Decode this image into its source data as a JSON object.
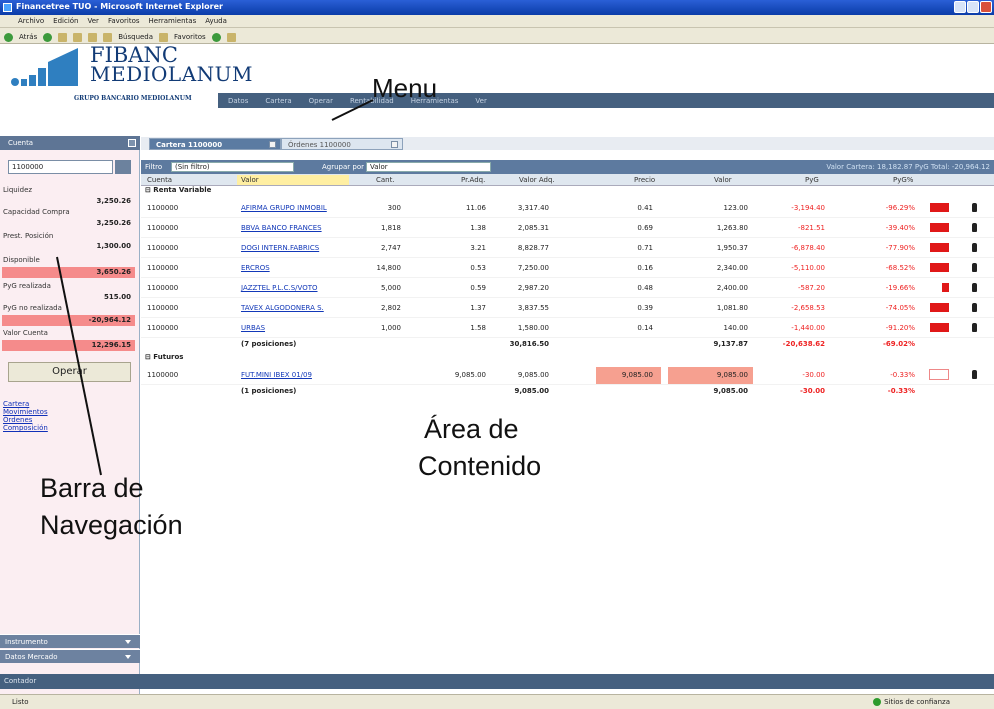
{
  "window": {
    "title": "Financetree TUO - Microsoft Internet Explorer"
  },
  "browser_menu": [
    "Archivo",
    "Edición",
    "Ver",
    "Favoritos",
    "Herramientas",
    "Ayuda"
  ],
  "browser_toolbar": {
    "back": "Atrás",
    "search": "Búsqueda",
    "favorites": "Favoritos"
  },
  "brand": {
    "line1": "FIBANC",
    "line2": "MEDIOLANUM",
    "tagline": "GRUPO BANCARIO MEDIOLANUM"
  },
  "app_menu": [
    "Datos",
    "Cartera",
    "Operar",
    "Rentabilidad",
    "Herramientas",
    "Ver"
  ],
  "overlays": {
    "menu": "Menu",
    "content_l1": "Área de",
    "content_l2": "Contenido",
    "nav_l1": "Barra de",
    "nav_l2": "Navegación"
  },
  "sidebar": {
    "header": "Cuenta",
    "account": "1100000",
    "items": [
      {
        "label": "Liquidez",
        "value": "3,250.26"
      },
      {
        "label": "Capacidad Compra",
        "value": "3,250.26"
      },
      {
        "label": "Prest. Posición",
        "value": "1,300.00"
      },
      {
        "label": "Disponible",
        "value": "3,650.26"
      },
      {
        "label": "PyG realizada",
        "value": "515.00"
      },
      {
        "label": "PyG no realizada",
        "value": "-20,964.12"
      },
      {
        "label": "Valor Cuenta",
        "value": "12,296.15"
      }
    ],
    "operar": "Operar",
    "links": [
      "Cartera",
      "Movimientos",
      "Órdenes",
      "Composición"
    ],
    "bottom": [
      "Instrumento",
      "Datos Mercado",
      "Contador"
    ]
  },
  "content": {
    "tabs": [
      "Cartera 1100000",
      "Órdenes 1100000"
    ],
    "filter": {
      "label": "Filtro",
      "value": "(Sin filtro)",
      "group_label": "Agrupar por",
      "group_value": "Valor"
    },
    "summary": "Valor Cartera: 18,182.87  PyG Total: -20,964.12",
    "columns": [
      "Cuenta",
      "Valor",
      "Cant.",
      "Pr.Adq.",
      "Valor Adq.",
      "Precio",
      "Valor",
      "PyG",
      "PyG%"
    ],
    "groups": [
      {
        "name": "Renta Variable",
        "rows": [
          {
            "account": "1100000",
            "valor": "AFIRMA GRUPO INMOBIL",
            "cant": "300",
            "pradq": "11.06",
            "valoradq": "3,317.40",
            "precio": "0.41",
            "valorcur": "123.00",
            "pyg": "-3,194.40",
            "pygpct": "-96.29%",
            "bar": 0.96
          },
          {
            "account": "1100000",
            "valor": "BBVA BANCO FRANCES",
            "cant": "1,818",
            "pradq": "1.38",
            "valoradq": "2,085.31",
            "precio": "0.69",
            "valorcur": "1,263.80",
            "pyg": "-821.51",
            "pygpct": "-39.40%",
            "bar": 0.96
          },
          {
            "account": "1100000",
            "valor": "DOGI INTERN.FABRICS",
            "cant": "2,747",
            "pradq": "3.21",
            "valoradq": "8,828.77",
            "precio": "0.71",
            "valorcur": "1,950.37",
            "pyg": "-6,878.40",
            "pygpct": "-77.90%",
            "bar": 0.96
          },
          {
            "account": "1100000",
            "valor": "ERCROS",
            "cant": "14,800",
            "pradq": "0.53",
            "valoradq": "7,250.00",
            "precio": "0.16",
            "valorcur": "2,340.00",
            "pyg": "-5,110.00",
            "pygpct": "-68.52%",
            "bar": 0.96
          },
          {
            "account": "1100000",
            "valor": "JAZZTEL P.L.C.S/VOTO",
            "cant": "5,000",
            "pradq": "0.59",
            "valoradq": "2,987.20",
            "precio": "0.48",
            "valorcur": "2,400.00",
            "pyg": "-587.20",
            "pygpct": "-19.66%",
            "bar": 0.35
          },
          {
            "account": "1100000",
            "valor": "TAVEX ALGODONERA S.",
            "cant": "2,802",
            "pradq": "1.37",
            "valoradq": "3,837.55",
            "precio": "0.39",
            "valorcur": "1,081.80",
            "pyg": "-2,658.53",
            "pygpct": "-74.05%",
            "bar": 0.96
          },
          {
            "account": "1100000",
            "valor": "URBAS",
            "cant": "1,000",
            "pradq": "1.58",
            "valoradq": "1,580.00",
            "precio": "0.14",
            "valorcur": "140.00",
            "pyg": "-1,440.00",
            "pygpct": "-91.20%",
            "bar": 0.96
          }
        ],
        "total": {
          "label": "(7 posiciones)",
          "valoradq": "30,816.50",
          "valorcur": "9,137.87",
          "pyg": "-20,638.62",
          "pygpct": "-69.02%"
        }
      },
      {
        "name": "Futuros",
        "rows": [
          {
            "account": "1100000",
            "valor": "FUT.MINI IBEX 01/09",
            "cant": "",
            "pradq": "9,085.00",
            "valoradq": "9,085.00",
            "precio": "9,085.00",
            "valorcur": "9,085.00",
            "pyg": "-30.00",
            "pygpct": "-0.33%",
            "bar": 0
          }
        ],
        "total": {
          "label": "(1 posiciones)",
          "valoradq": "9,085.00",
          "valorcur": "9,085.00",
          "pyg": "-30.00",
          "pygpct": "-0.33%"
        }
      }
    ]
  },
  "status_strip": "Contador",
  "ie_status": {
    "left": "Listo",
    "right": "Sitios de confianza"
  }
}
